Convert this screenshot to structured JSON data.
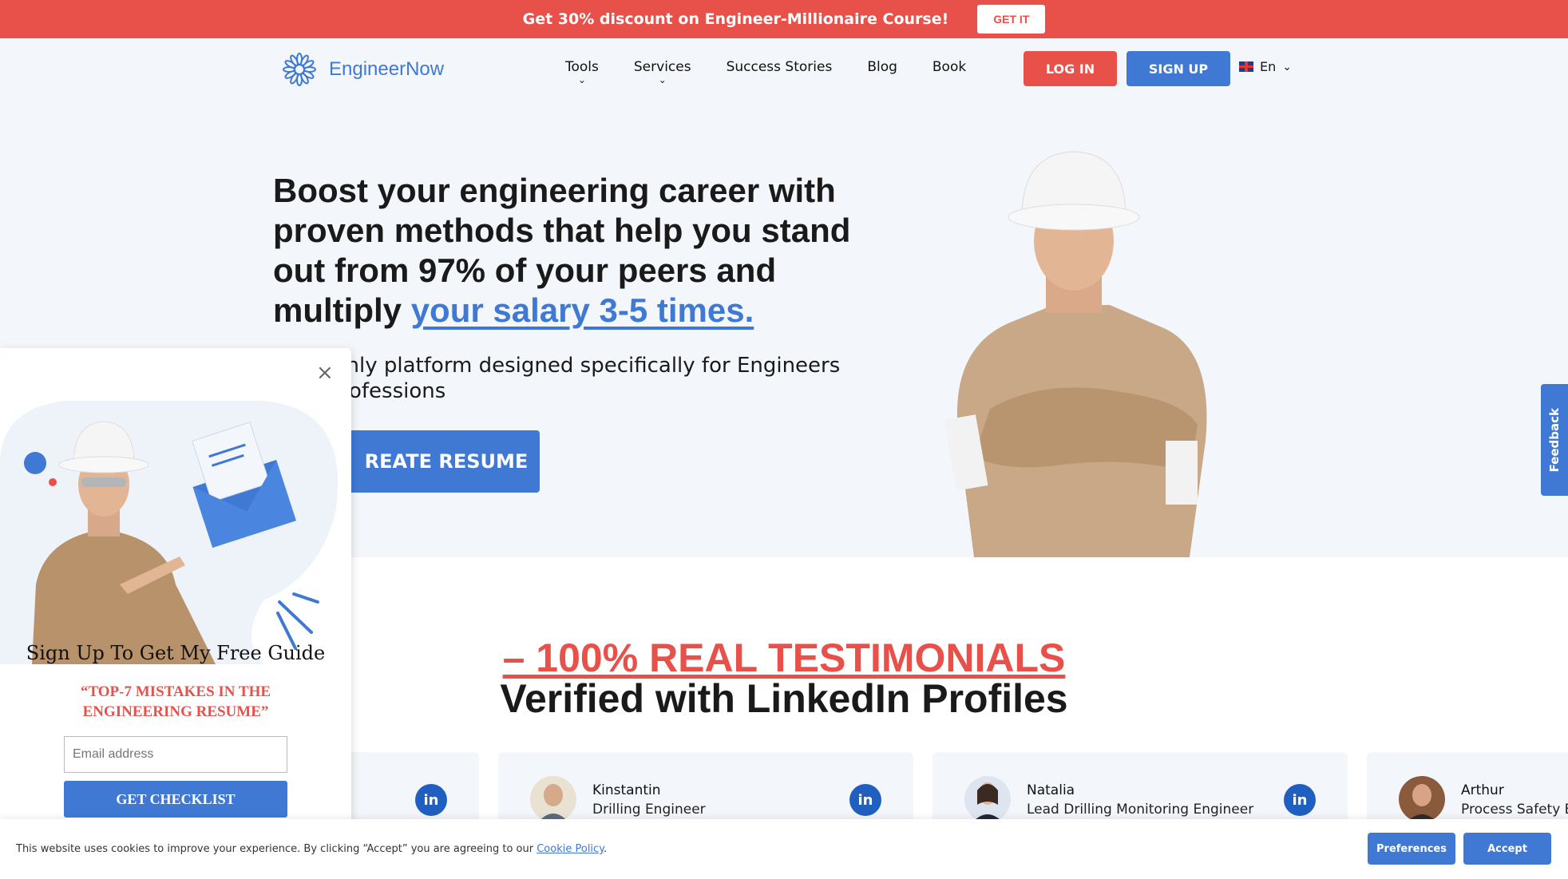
{
  "promo": {
    "text": "Get 30% discount on Engineer-Millionaire Course!",
    "button": "GET IT"
  },
  "header": {
    "logo_text": "EngineerNow",
    "nav": [
      {
        "label": "Tools",
        "has_dropdown": true
      },
      {
        "label": "Services",
        "has_dropdown": true
      },
      {
        "label": "Success Stories",
        "has_dropdown": false
      },
      {
        "label": "Blog",
        "has_dropdown": false
      },
      {
        "label": "Book",
        "has_dropdown": false
      }
    ],
    "login": "LOG IN",
    "signup": "SIGN UP",
    "language": "En"
  },
  "hero": {
    "headline_main": "Boost your engineering career with proven methods that help you stand out from 97% of your peers and multiply ",
    "headline_highlight": "your salary 3-5 times.",
    "subline": "t and only platform designed specifically for Engineers ofessions",
    "subline_line1": "t and only platform designed specifically for Engineers",
    "subline_line2": "ofessions",
    "cta": "REATE RESUME"
  },
  "feedback": {
    "label": "Feedback"
  },
  "testimonials": {
    "title": "– 100% REAL TESTIMONIALS",
    "subtitle": "Verified with LinkedIn Profiles",
    "cards": [
      {
        "name": "Kinstantin",
        "role": "Drilling Engineer"
      },
      {
        "name": "Natalia",
        "role": "Lead Drilling Monitoring Engineer"
      },
      {
        "name": "Arthur",
        "role": "Process Safety E"
      }
    ],
    "linkedin_label": "in"
  },
  "popup": {
    "title": "Sign Up To Get My Free Guide",
    "guide_line1": "“TOP-7 MISTAKES IN THE",
    "guide_line2": "ENGINEERING RESUME”",
    "email_placeholder": "Email address",
    "button": "GET CHECKLIST"
  },
  "cookie": {
    "text": "This website uses cookies to improve your experience. By clicking “Accept” you are agreeing to our ",
    "link": "Cookie Policy",
    "suffix": ".",
    "preferences": "Preferences",
    "accept": "Accept"
  },
  "colors": {
    "accent_red": "#e8514a",
    "accent_blue": "#3f79d4",
    "hero_bg": "#f3f6fa"
  }
}
